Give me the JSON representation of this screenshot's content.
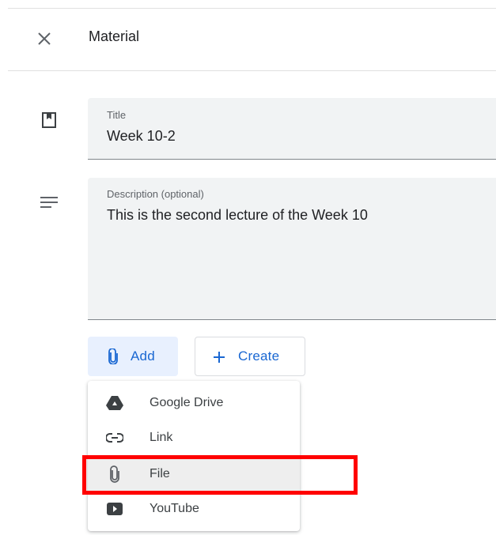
{
  "header": {
    "title": "Material",
    "close_icon": "close-icon"
  },
  "form": {
    "title_field": {
      "label": "Title",
      "value": "Week 10-2",
      "icon": "bookmark-icon"
    },
    "description_field": {
      "label": "Description (optional)",
      "value": "This is the second lecture of the Week 10",
      "icon": "notes-icon"
    }
  },
  "buttons": {
    "add_label": "Add",
    "create_label": "Create"
  },
  "add_menu": {
    "items": [
      {
        "label": "Google Drive",
        "icon": "google-drive-icon"
      },
      {
        "label": "Link",
        "icon": "link-icon"
      },
      {
        "label": "File",
        "icon": "attachment-icon",
        "selected": true
      },
      {
        "label": "YouTube",
        "icon": "youtube-icon"
      }
    ]
  },
  "colors": {
    "accent": "#1967d2",
    "add_button_bg": "#e8f0fe",
    "field_bg": "#f1f3f4",
    "highlight": "#ff0000"
  }
}
